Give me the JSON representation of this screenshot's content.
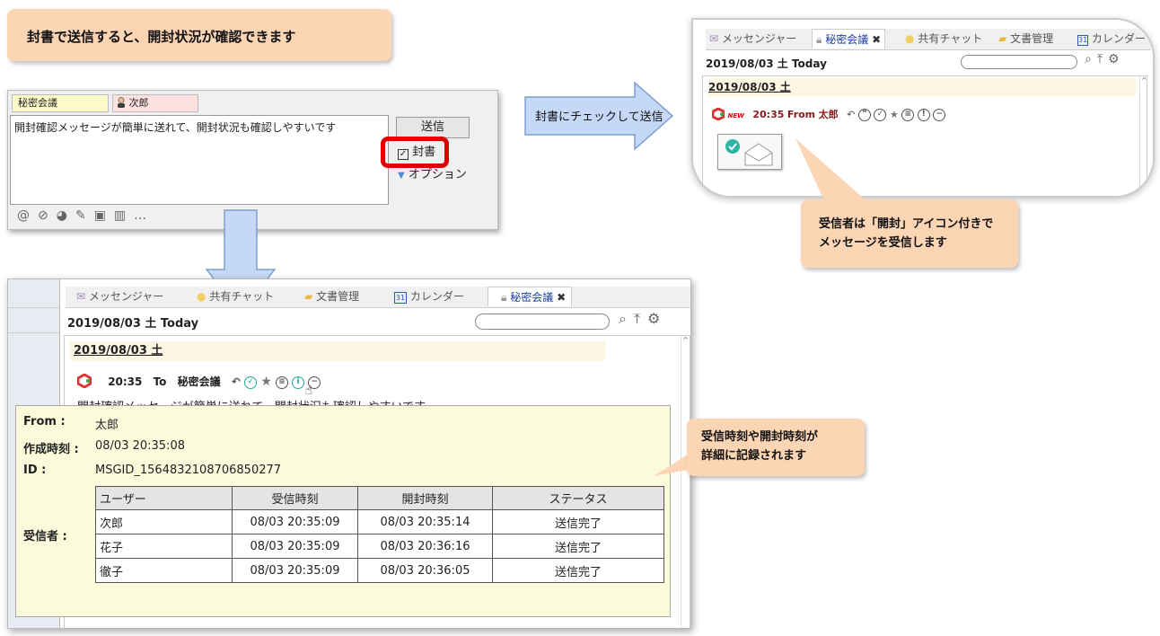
{
  "callouts": {
    "top": "封書で送信すると、開封状況が確認できます",
    "arrow_label": "封書にチェックして送信",
    "receiver": [
      "受信者は「開封」アイコン付きで",
      "メッセージを受信します"
    ],
    "detail": [
      "受信時刻や開封時刻が",
      "詳細に記録されます"
    ]
  },
  "compose": {
    "room_tab": "秘密会議",
    "user_tab": "次郎",
    "message": "開封確認メッセージが簡単に送れて、開封状況も確認しやすいです",
    "send_label": "送信",
    "envelope_label": "封書",
    "options_label": "オプション"
  },
  "receiver_view": {
    "tabs": [
      "メッセンジャー",
      "秘密会議",
      "共有チャット",
      "文書管理",
      "カレンダー"
    ],
    "calendar_num": "31",
    "date_header": "2019/08/03 土 Today",
    "date_line": "2019/08/03 土",
    "new_badge": "NEW",
    "msg_time": "20:35",
    "msg_from_label": "From",
    "msg_sender": "太郎"
  },
  "sender_view": {
    "tabs": [
      "メッセンジャー",
      "共有チャット",
      "文書管理",
      "カレンダー",
      "秘密会議"
    ],
    "calendar_num": "31",
    "date_header": "2019/08/03 土 Today",
    "date_line": "2019/08/03 土",
    "msg_time": "20:35",
    "msg_to_label": "To",
    "msg_room": "秘密会議",
    "msg_preview": "開封確認メッセージが簡単に送れて、開封状況も確認しやすいです"
  },
  "detail": {
    "from_label": "From :",
    "from_value": "太郎",
    "created_label": "作成時刻 :",
    "created_value": "08/03 20:35:08",
    "id_label": "ID :",
    "id_value": "MSGID_1564832108706850277",
    "recipients_label": "受信者 :",
    "columns": [
      "ユーザー",
      "受信時刻",
      "開封時刻",
      "ステータス"
    ],
    "rows": [
      [
        "次郎",
        "08/03 20:35:09",
        "08/03 20:35:14",
        "送信完了"
      ],
      [
        "花子",
        "08/03 20:35:09",
        "08/03 20:36:16",
        "送信完了"
      ],
      [
        "徹子",
        "08/03 20:35:09",
        "08/03 20:36:05",
        "送信完了"
      ]
    ]
  },
  "colors": {
    "callout_bg": "#fcd5b5",
    "highlight_red": "#e00000",
    "tooltip_bg": "#fbfbdc",
    "arrow_blue": "#c5d8f8"
  }
}
